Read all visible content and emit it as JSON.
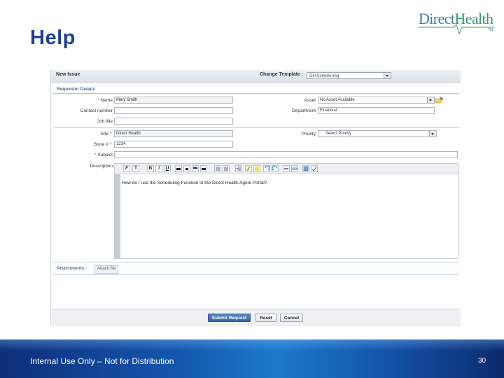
{
  "slide": {
    "title": "Help",
    "footer": "Internal Use Only – Not for Distribution",
    "page_number": "30"
  },
  "logo": {
    "part1": "Direct",
    "part2": "Health",
    "tm": "TM"
  },
  "app": {
    "window_title": "New Issue",
    "change_template_label": "Change Template :",
    "template_value": "Del Schedu ling",
    "requester_section": "Requester Details",
    "fields": {
      "name": {
        "label": "Name",
        "value": "Mary Smith"
      },
      "contact_number": {
        "label": "Contact number",
        "value": ""
      },
      "job_title": {
        "label": "Job title",
        "value": ""
      },
      "site": {
        "label": "Site",
        "value": "Direct Health"
      },
      "store": {
        "label": "Store #",
        "value": "1234"
      },
      "subject": {
        "label": "Subject",
        "value": ""
      },
      "description": {
        "label": "Description"
      },
      "asset": {
        "label": "Asset",
        "value": "No Asset Available"
      },
      "department": {
        "label": "Department",
        "value": "Financial"
      },
      "priority": {
        "label": "Priority",
        "value": "Select Priority"
      }
    },
    "description_text": "How do I use the Scheduling Function in the Direct Health Agent Portal?",
    "toolbar": {
      "font": "F",
      "size": "T",
      "bold": "B",
      "italic": "I",
      "underline": "U"
    },
    "attachments_label": "Attachments :",
    "attach_file_button": "Attach file",
    "buttons": {
      "submit": "Submit Request",
      "reset": "Reset",
      "cancel": "Cancel"
    }
  },
  "colors": {
    "title": "#1f3d99",
    "accent": "#3463a5"
  }
}
